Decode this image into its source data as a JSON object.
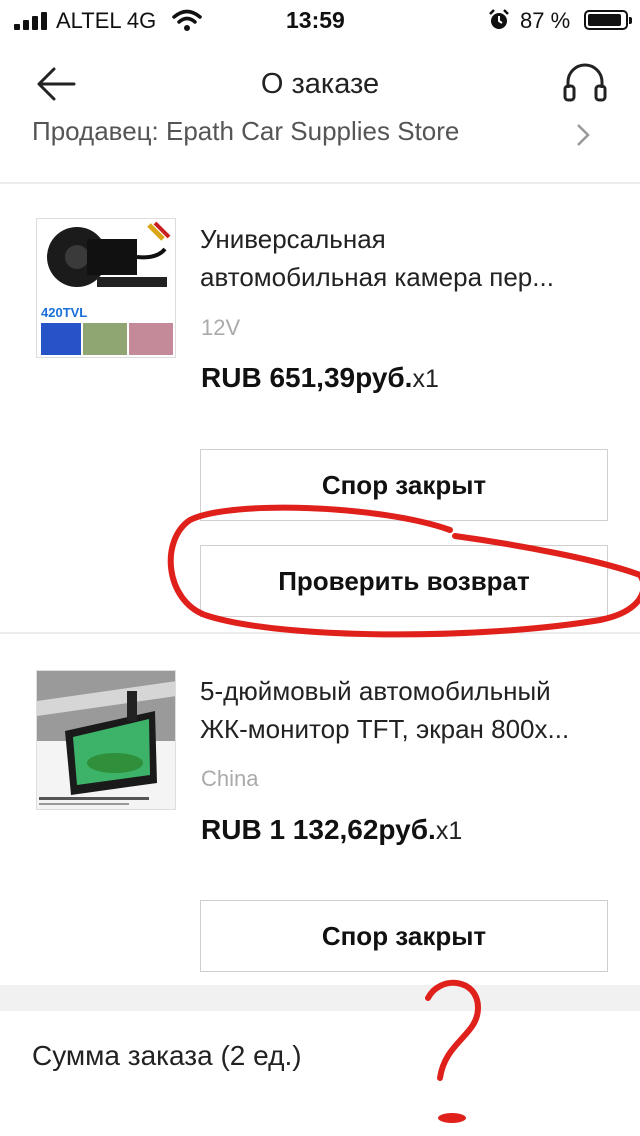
{
  "status_bar": {
    "carrier": "ALTEL 4G",
    "time": "13:59",
    "battery_percent": "87 %"
  },
  "header": {
    "title": "О заказе",
    "back_icon": "arrow-left-icon",
    "support_icon": "headset-icon"
  },
  "seller": {
    "label": "Продавец: Epath Car Supplies Store",
    "chevron_icon": "chevron-right-icon"
  },
  "products": [
    {
      "title_line1": "Универсальная",
      "title_line2": "автомобильная камера пер...",
      "variant": "12V",
      "price": "RUB 651,39руб.",
      "qty": "x1",
      "thumb_badge": "420TVL",
      "buttons": [
        "Спор закрыт",
        "Проверить возврат"
      ]
    },
    {
      "title_line1": "5-дюймовый автомобильный",
      "title_line2": "ЖК-монитор TFT, экран 800x...",
      "variant": "China",
      "price": "RUB 1 132,62руб.",
      "qty": "x1",
      "buttons": [
        "Спор закрыт"
      ]
    }
  ],
  "summary": {
    "label": "Сумма заказа (2 ед.)"
  },
  "colors": {
    "annotation_red": "#e0201b",
    "button_border": "#cfcfcf",
    "muted_text": "#aaaaaa"
  }
}
